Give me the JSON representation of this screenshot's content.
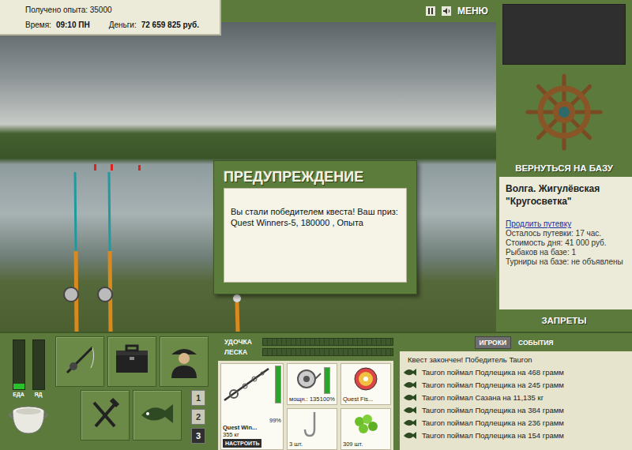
{
  "stats": {
    "experience": "Получено опыта: 35000",
    "time_label": "Время:",
    "time": "09:10 ПН",
    "money_label": "Деньги:",
    "money": "72 659 825 руб."
  },
  "toolbar": {
    "menu": "МЕНЮ"
  },
  "dialog": {
    "title": "ПРЕДУПРЕЖДЕНИЕ",
    "message": "Вы стали победителем квеста! Ваш приз: Quest Winners-5, 180000 , Опыта"
  },
  "base": {
    "return": "ВЕРНУТЬСЯ НА БАЗУ",
    "location": "Волга. Жигулёвская",
    "name": "\"Кругосветка\"",
    "extend": "Продлить путевку",
    "details": [
      "Осталось путевки: 17 час.",
      "Стоимость дня: 41 000 руб.",
      "Рыбаков на базе: 1",
      "Турниры на базе: не объявлены"
    ],
    "bans": "ЗАПРЕТЫ"
  },
  "needs": [
    {
      "label": "ЕДА",
      "level": 0.12
    },
    {
      "label": "ЯД",
      "level": 0
    }
  ],
  "pages": [
    {
      "label": "1",
      "selected": false
    },
    {
      "label": "2",
      "selected": false
    },
    {
      "label": "3",
      "selected": true
    }
  ],
  "tension": [
    {
      "label": "УДОЧКА",
      "level": 0
    },
    {
      "label": "ЛЕСКА",
      "level": 0
    }
  ],
  "rod": {
    "name": "Quest Win...",
    "strength": "355 кг",
    "button": "НАСТРОИТЬ",
    "reading": "99%",
    "level": 0.99
  },
  "tackle": [
    {
      "kind": "reel",
      "caption": "мощн.: 135",
      "reading": "100%",
      "level": 1
    },
    {
      "kind": "line",
      "caption": "Quest Fis..."
    },
    {
      "kind": "hook",
      "caption": "3 шт."
    },
    {
      "kind": "bait",
      "caption": "309 шт."
    }
  ],
  "log": {
    "tabs": [
      {
        "label": "ИГРОКИ",
        "selected": true
      },
      {
        "label": "СОБЫТИЯ",
        "selected": false
      }
    ],
    "entries": [
      {
        "kind": "notice",
        "text": "Квест закончен! Победитель Tauron"
      },
      {
        "kind": "catch",
        "text": "Tauron поймал Подлещика на 468 грамм"
      },
      {
        "kind": "catch",
        "text": "Tauron поймал Подлещика на 245 грамм"
      },
      {
        "kind": "catch",
        "text": "Tauron поймал Сазана на 11,135 кг"
      },
      {
        "kind": "catch",
        "text": "Tauron поймал Подлещика на 384 грамм"
      },
      {
        "kind": "catch",
        "text": "Tauron поймал Подлещика на 236 грамм"
      },
      {
        "kind": "catch",
        "text": "Tauron поймал Подлещика на 154 грамм"
      }
    ]
  }
}
